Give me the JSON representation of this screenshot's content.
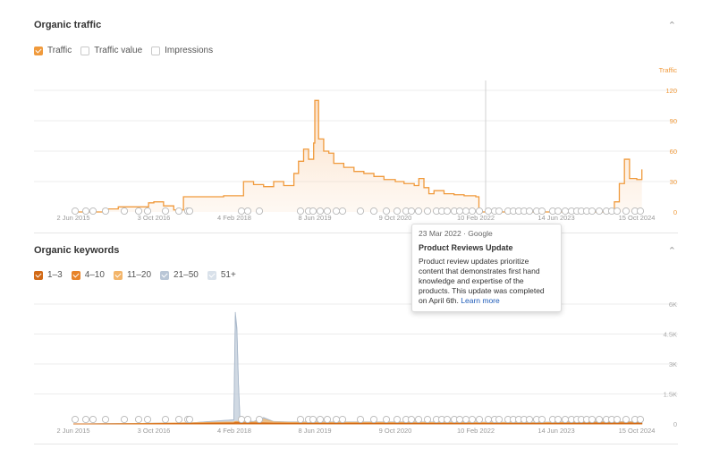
{
  "traffic_section": {
    "title": "Organic traffic",
    "legend": [
      {
        "label": "Traffic",
        "checked": true,
        "color": "#f09a3c"
      },
      {
        "label": "Traffic value",
        "checked": false,
        "color": "#c9c9c9"
      },
      {
        "label": "Impressions",
        "checked": false,
        "color": "#c9c9c9"
      }
    ]
  },
  "keywords_section": {
    "title": "Organic keywords",
    "legend": [
      {
        "label": "1–3",
        "checked": true,
        "color": "#d26a16"
      },
      {
        "label": "4–10",
        "checked": true,
        "color": "#e8842a"
      },
      {
        "label": "11–20",
        "checked": true,
        "color": "#f3b56a"
      },
      {
        "label": "21–50",
        "checked": true,
        "color": "#b9c6d6"
      },
      {
        "label": "51+",
        "checked": true,
        "color": "#d9e1ea"
      }
    ]
  },
  "tooltip": {
    "date": "23 Mar 2022 · Google",
    "title": "Product Reviews Update",
    "body": "Product review updates prioritize content that demonstrates first hand knowledge and expertise of the products. This update was completed on April 6th.",
    "link": "Learn more"
  },
  "colors": {
    "accent": "#f09a3c",
    "grid": "#ececec",
    "axis_text": "#999999"
  },
  "chart_data": [
    {
      "type": "line",
      "title": "Organic traffic",
      "ylabel": "Traffic",
      "ylim": [
        0,
        120
      ],
      "y_ticks": [
        "0",
        "30",
        "60",
        "90",
        "120"
      ],
      "x_ticks": [
        "2 Jun 2015",
        "3 Oct 2016",
        "4 Feb 2018",
        "8 Jun 2019",
        "9 Oct 2020",
        "10 Feb 2022",
        "14 Jun 2023",
        "15 Oct 2024"
      ],
      "series": [
        {
          "x": [
            "2015-06-02",
            "2015-12-01",
            "2016-03-01",
            "2016-06-01",
            "2016-09-01",
            "2016-10-03",
            "2016-12-01",
            "2017-02-01",
            "2017-04-01",
            "2017-06-01",
            "2017-09-01",
            "2017-12-01",
            "2018-02-04",
            "2018-04-01",
            "2018-06-01",
            "2018-08-01",
            "2018-10-01",
            "2018-12-01",
            "2019-02-01",
            "2019-03-01",
            "2019-04-01",
            "2019-05-01",
            "2019-06-01",
            "2019-06-08",
            "2019-07-01",
            "2019-08-01",
            "2019-09-01",
            "2019-10-01",
            "2019-12-01",
            "2020-02-01",
            "2020-04-01",
            "2020-06-01",
            "2020-08-01",
            "2020-10-09",
            "2020-12-01",
            "2021-02-01",
            "2021-03-01",
            "2021-04-01",
            "2021-05-01",
            "2021-06-01",
            "2021-08-01",
            "2021-10-01",
            "2021-12-01",
            "2022-02-10",
            "2022-03-01",
            "2022-06-01",
            "2022-10-01",
            "2023-02-01",
            "2023-06-14",
            "2023-10-01",
            "2024-02-01",
            "2024-05-01",
            "2024-06-01",
            "2024-07-01",
            "2024-08-01",
            "2024-09-01",
            "2024-10-15",
            "2024-11-15"
          ],
          "y": [
            0,
            3,
            5,
            5,
            9,
            10,
            6,
            2,
            15,
            15,
            15,
            16,
            16,
            30,
            27,
            25,
            30,
            26,
            38,
            50,
            62,
            52,
            68,
            110,
            72,
            60,
            58,
            48,
            44,
            40,
            38,
            35,
            32,
            30,
            28,
            26,
            33,
            24,
            18,
            21,
            18,
            17,
            16,
            15,
            0,
            0,
            0,
            0,
            0,
            0,
            0,
            2,
            10,
            28,
            52,
            33,
            32,
            42
          ]
        }
      ]
    },
    {
      "type": "area",
      "title": "Organic keywords",
      "ylim": [
        0,
        6000
      ],
      "y_ticks": [
        "0",
        "1.5K",
        "3K",
        "4.5K",
        "6K"
      ],
      "x_ticks": [
        "2 Jun 2015",
        "3 Oct 2016",
        "4 Feb 2018",
        "8 Jun 2019",
        "9 Oct 2020",
        "10 Feb 2022",
        "14 Jun 2023",
        "15 Oct 2024"
      ],
      "x": [
        "2015-06-02",
        "2016-06-01",
        "2017-06-01",
        "2018-02-01",
        "2018-02-10",
        "2018-02-20",
        "2018-03-01",
        "2018-03-10",
        "2018-04-01",
        "2018-06-01",
        "2018-08-01",
        "2018-10-01",
        "2019-01-01",
        "2020-01-01",
        "2021-01-01",
        "2022-01-01",
        "2023-01-01",
        "2024-01-01",
        "2024-11-15"
      ],
      "series": [
        {
          "name": "1–3",
          "values": [
            0,
            0,
            20,
            40,
            60,
            60,
            60,
            50,
            40,
            40,
            40,
            30,
            30,
            30,
            30,
            20,
            20,
            30,
            30
          ]
        },
        {
          "name": "4–10",
          "values": [
            0,
            10,
            40,
            60,
            90,
            90,
            90,
            70,
            60,
            60,
            60,
            50,
            40,
            40,
            40,
            40,
            30,
            60,
            60
          ]
        },
        {
          "name": "11–20",
          "values": [
            0,
            20,
            60,
            100,
            120,
            130,
            120,
            100,
            90,
            90,
            240,
            100,
            80,
            80,
            80,
            70,
            60,
            90,
            100
          ]
        },
        {
          "name": "21–50",
          "values": [
            0,
            20,
            60,
            200,
            5400,
            4600,
            2000,
            300,
            150,
            110,
            300,
            110,
            90,
            90,
            90,
            80,
            70,
            100,
            110
          ]
        },
        {
          "name": "51+",
          "values": [
            0,
            20,
            60,
            210,
            5600,
            4800,
            2100,
            320,
            160,
            120,
            320,
            120,
            100,
            100,
            100,
            90,
            80,
            110,
            120
          ]
        }
      ]
    }
  ]
}
